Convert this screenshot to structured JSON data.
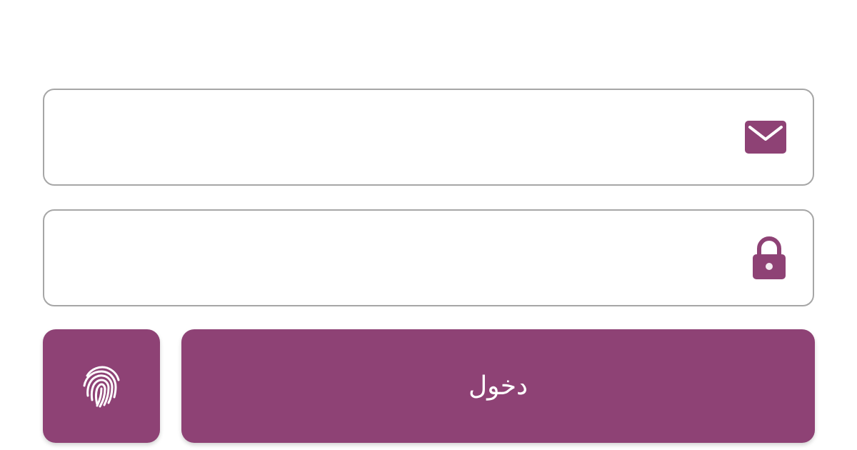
{
  "theme": {
    "accent": "#8e4275",
    "field_border": "#a6a6a6",
    "background": "#ffffff"
  },
  "email_field": {
    "value": "",
    "placeholder": "",
    "icon": "envelope-icon"
  },
  "password_field": {
    "value": "",
    "placeholder": "",
    "icon": "lock-icon"
  },
  "fingerprint_button": {
    "icon": "fingerprint-icon"
  },
  "login_button": {
    "label": "دخول"
  }
}
